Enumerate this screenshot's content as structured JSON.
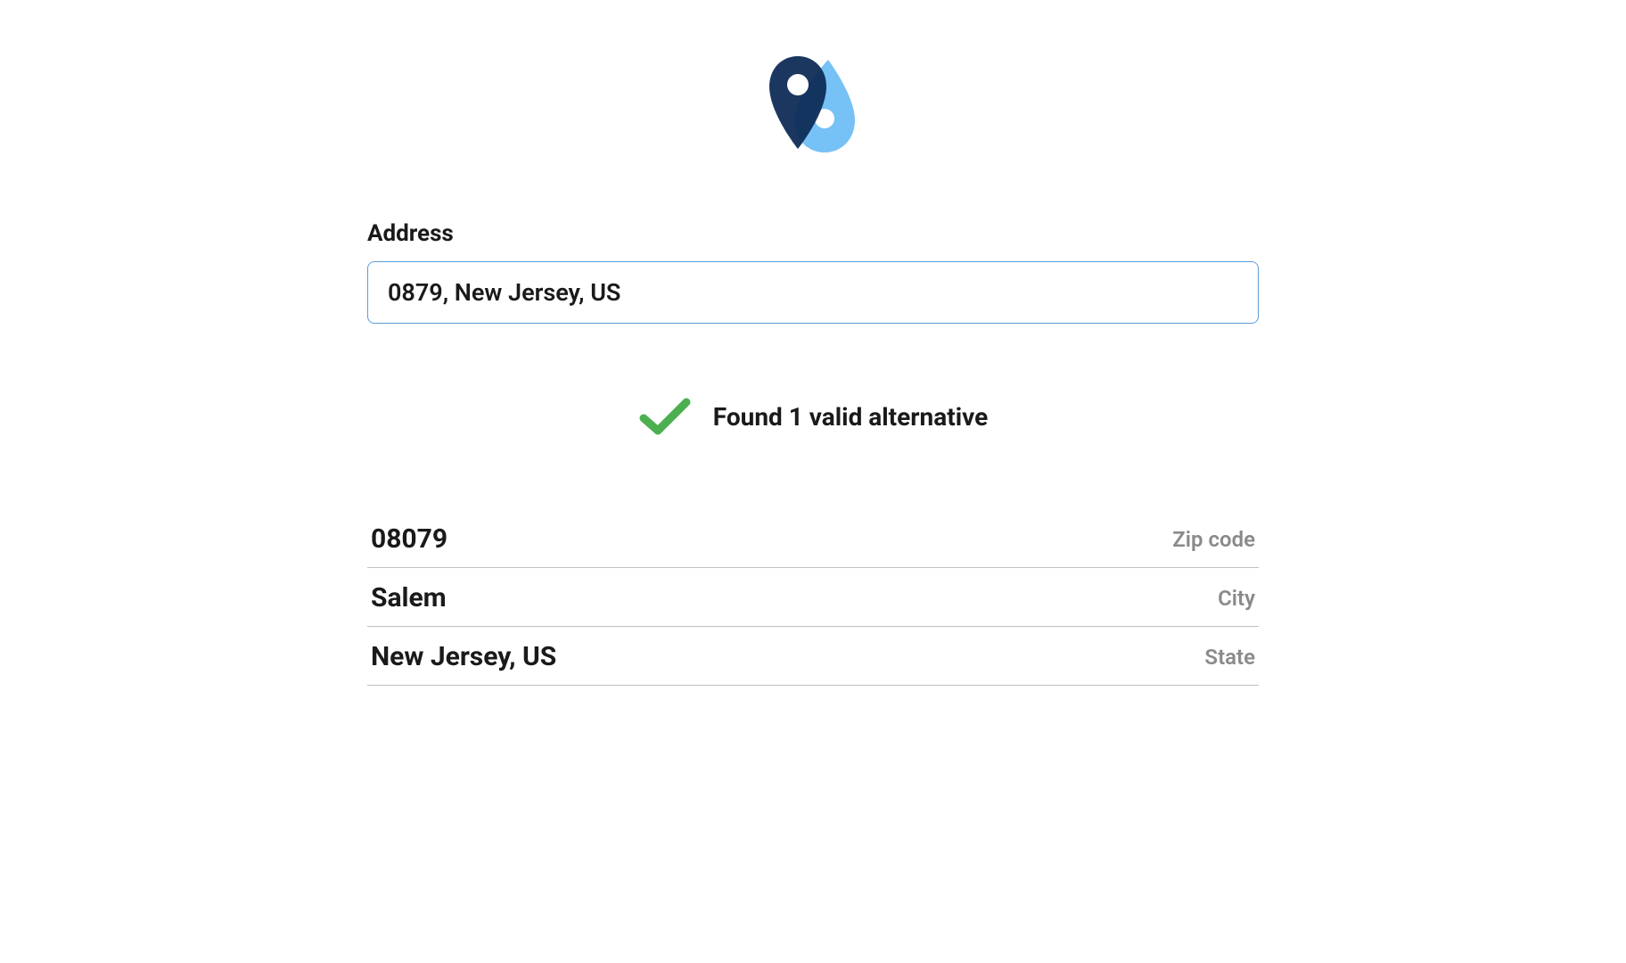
{
  "form": {
    "addressLabel": "Address",
    "addressValue": "0879, New Jersey, US"
  },
  "status": {
    "message": "Found 1 valid alternative"
  },
  "results": [
    {
      "value": "08079",
      "label": "Zip code"
    },
    {
      "value": "Salem",
      "label": "City"
    },
    {
      "value": "New Jersey, US",
      "label": "State"
    }
  ],
  "colors": {
    "darkNavy": "#0f2c57",
    "lightBlue": "#6fbef5",
    "checkGreen": "#4caf50",
    "borderBlue": "#5b9dd9",
    "grayLabel": "#8a8a8a"
  }
}
